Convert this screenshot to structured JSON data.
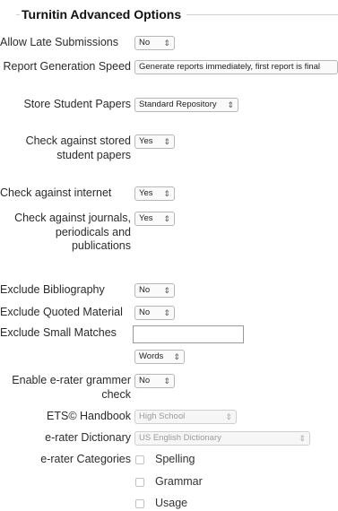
{
  "section": {
    "title": "Turnitin Advanced Options"
  },
  "fields": {
    "allow_late": {
      "label": "Allow Late Submissions",
      "value": "No"
    },
    "report_speed": {
      "label": "Report Generation Speed",
      "value": "Generate reports immediately, first report is final"
    },
    "store_papers": {
      "label": "Store Student Papers",
      "value": "Standard Repository"
    },
    "check_stored": {
      "label": "Check against stored student papers",
      "value": "Yes"
    },
    "check_internet": {
      "label": "Check against internet",
      "value": "Yes"
    },
    "check_journals": {
      "label": "Check against journals, periodicals and publications",
      "value": "Yes"
    },
    "exclude_bib": {
      "label": "Exclude Bibliography",
      "value": "No"
    },
    "exclude_quoted": {
      "label": "Exclude Quoted Material",
      "value": "No"
    },
    "exclude_small": {
      "label": "Exclude Small Matches",
      "value": "",
      "unit": "Words"
    },
    "erater_enable": {
      "label": "Enable e-rater grammer check",
      "value": "No"
    },
    "ets_handbook": {
      "label": "ETS© Handbook",
      "value": "High School"
    },
    "erater_dict": {
      "label": "e-rater Dictionary",
      "value": "US English Dictionary"
    },
    "erater_categories": {
      "label": "e-rater Categories",
      "options": [
        "Spelling",
        "Grammar",
        "Usage"
      ]
    }
  },
  "glyphs": {
    "select_arrow": "⇕"
  }
}
